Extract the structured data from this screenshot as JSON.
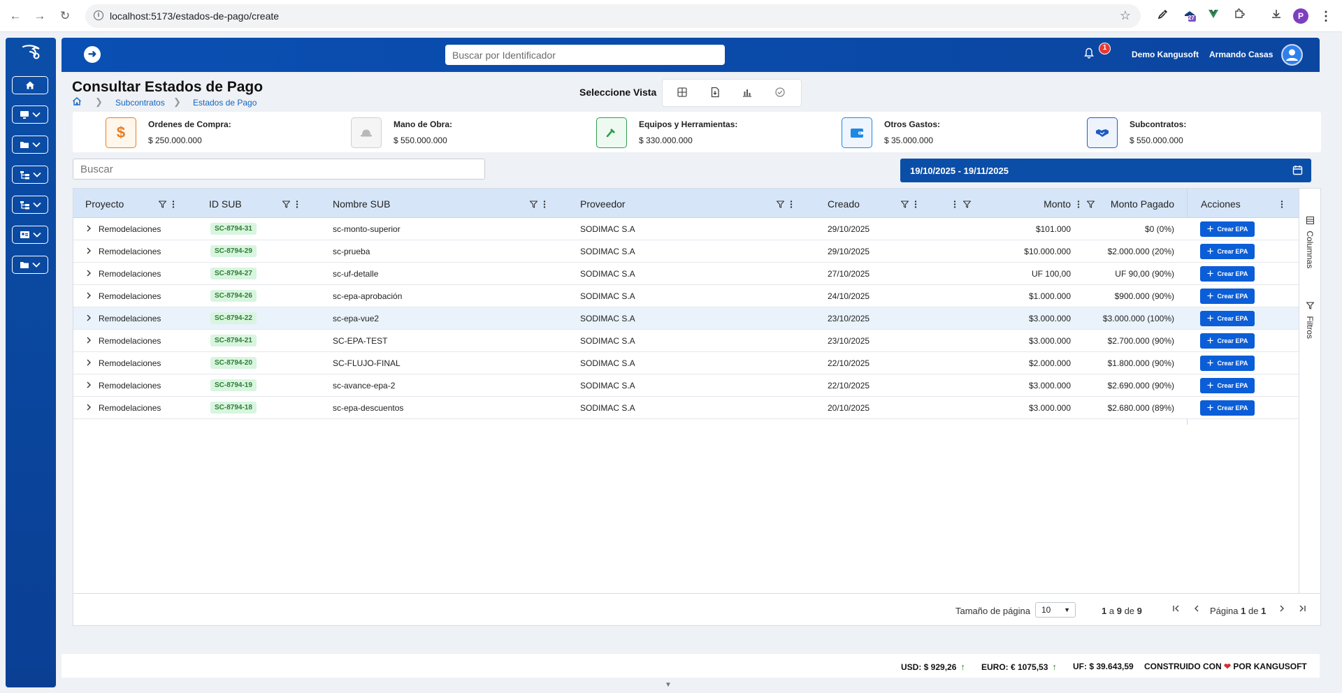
{
  "browser": {
    "url": "localhost:5173/estados-de-pago/create",
    "profile_initial": "P",
    "extension_badge": "27"
  },
  "header": {
    "search_placeholder": "Buscar por Identificador",
    "notification_count": "1",
    "company": "Demo Kangusoft",
    "user": "Armando Casas"
  },
  "page": {
    "title": "Consultar Estados de Pago",
    "breadcrumb": [
      "Subcontratos",
      "Estados de Pago"
    ],
    "view_label": "Seleccione Vista"
  },
  "summary": [
    {
      "title": "Ordenes de Compra:",
      "value": "$ 250.000.000",
      "icon": "dollar-icon",
      "color": "#e67e22"
    },
    {
      "title": "Mano de Obra:",
      "value": "$ 550.000.000",
      "icon": "hardhat-icon",
      "color": "#9e9e9e"
    },
    {
      "title": "Equipos y Herramientas:",
      "value": "$ 330.000.000",
      "icon": "hammer-icon",
      "color": "#2e9e4f"
    },
    {
      "title": "Otros Gastos:",
      "value": "$ 35.000.000",
      "icon": "wallet-icon",
      "color": "#1e88e5"
    },
    {
      "title": "Subcontratos:",
      "value": "$ 550.000.000",
      "icon": "handshake-icon",
      "color": "#1e5bbf"
    }
  ],
  "search": {
    "placeholder": "Buscar"
  },
  "date_range": "19/10/2025 - 19/11/2025",
  "table": {
    "headers": {
      "proyecto": "Proyecto",
      "id_sub": "ID SUB",
      "nombre_sub": "Nombre SUB",
      "proveedor": "Proveedor",
      "creado": "Creado",
      "monto": "Monto",
      "monto_pagado": "Monto Pagado",
      "acciones": "Acciones"
    },
    "action_label": "Crear EPA",
    "rows": [
      {
        "proyecto": "Remodelaciones",
        "id": "SC-8794-31",
        "nombre": "sc-monto-superior",
        "proveedor": "SODIMAC S.A",
        "creado": "29/10/2025",
        "monto": "$101.000",
        "pagado": "$0 (0%)"
      },
      {
        "proyecto": "Remodelaciones",
        "id": "SC-8794-29",
        "nombre": "sc-prueba",
        "proveedor": "SODIMAC S.A",
        "creado": "29/10/2025",
        "monto": "$10.000.000",
        "pagado": "$2.000.000 (20%)"
      },
      {
        "proyecto": "Remodelaciones",
        "id": "SC-8794-27",
        "nombre": "sc-uf-detalle",
        "proveedor": "SODIMAC S.A",
        "creado": "27/10/2025",
        "monto": "UF 100,00",
        "pagado": "UF 90,00 (90%)"
      },
      {
        "proyecto": "Remodelaciones",
        "id": "SC-8794-26",
        "nombre": "sc-epa-aprobación",
        "proveedor": "SODIMAC S.A",
        "creado": "24/10/2025",
        "monto": "$1.000.000",
        "pagado": "$900.000 (90%)"
      },
      {
        "proyecto": "Remodelaciones",
        "id": "SC-8794-22",
        "nombre": "sc-epa-vue2",
        "proveedor": "SODIMAC S.A",
        "creado": "23/10/2025",
        "monto": "$3.000.000",
        "pagado": "$3.000.000 (100%)"
      },
      {
        "proyecto": "Remodelaciones",
        "id": "SC-8794-21",
        "nombre": "SC-EPA-TEST",
        "proveedor": "SODIMAC S.A",
        "creado": "23/10/2025",
        "monto": "$3.000.000",
        "pagado": "$2.700.000 (90%)"
      },
      {
        "proyecto": "Remodelaciones",
        "id": "SC-8794-20",
        "nombre": "SC-FLUJO-FINAL",
        "proveedor": "SODIMAC S.A",
        "creado": "22/10/2025",
        "monto": "$2.000.000",
        "pagado": "$1.800.000 (90%)"
      },
      {
        "proyecto": "Remodelaciones",
        "id": "SC-8794-19",
        "nombre": "sc-avance-epa-2",
        "proveedor": "SODIMAC S.A",
        "creado": "22/10/2025",
        "monto": "$3.000.000",
        "pagado": "$2.690.000 (90%)"
      },
      {
        "proyecto": "Remodelaciones",
        "id": "SC-8794-18",
        "nombre": "sc-epa-descuentos",
        "proveedor": "SODIMAC S.A",
        "creado": "20/10/2025",
        "monto": "$3.000.000",
        "pagado": "$2.680.000 (89%)"
      }
    ]
  },
  "side_panel": {
    "columns": "Columnas",
    "filters": "Filtros"
  },
  "pagination": {
    "page_size_label": "Tamaño de página",
    "page_size": "10",
    "range_start": "1",
    "range_end": "9",
    "range_of": "a",
    "range_de": "de",
    "total": "9",
    "page_label": "Página",
    "page_of": "de",
    "page": "1",
    "pages": "1"
  },
  "footer": {
    "usd": "USD: $ 929,26",
    "euro": "EURO: € 1075,53",
    "uf": "UF: $ 39.643,59",
    "built_prefix": "CONSTRUIDO CON",
    "built_suffix": "POR KANGUSOFT"
  }
}
